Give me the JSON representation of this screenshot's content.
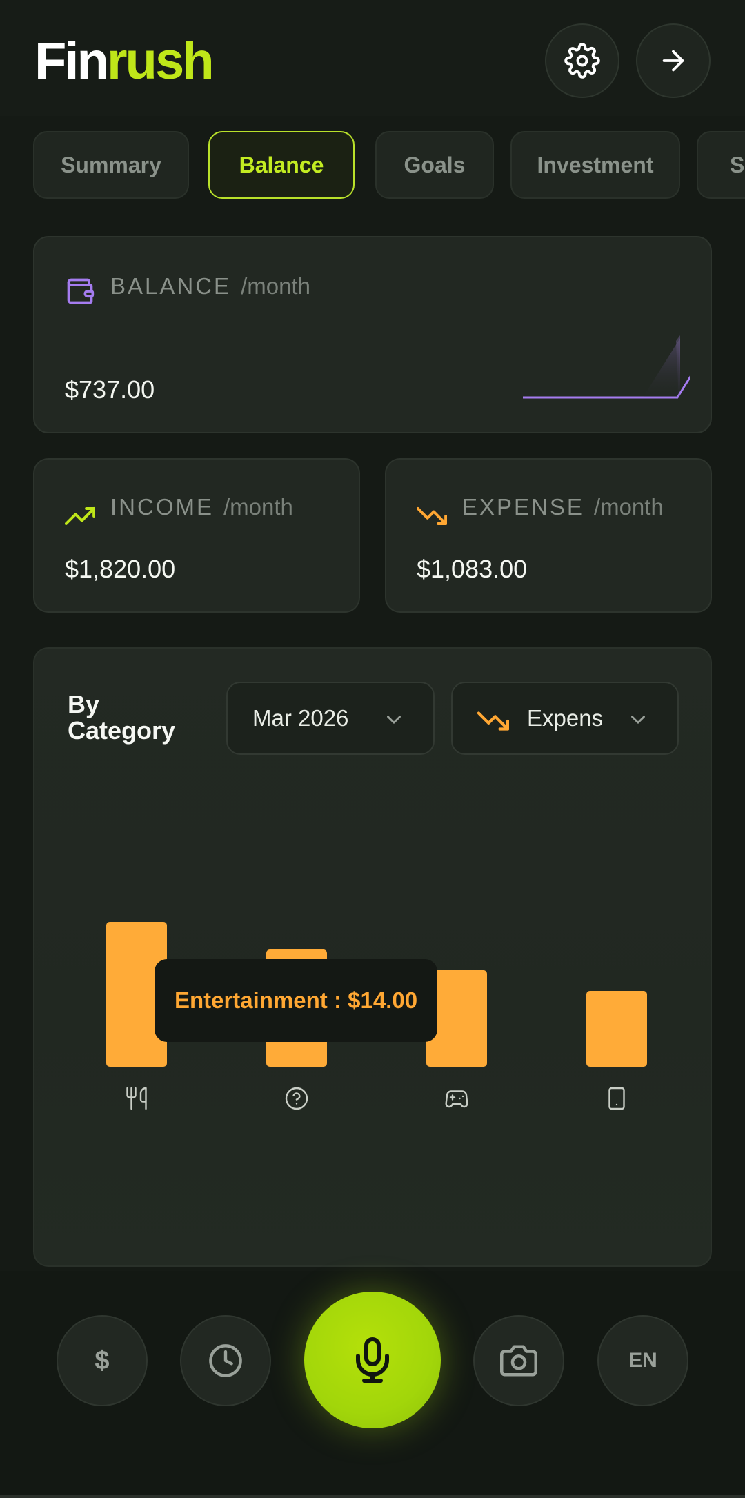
{
  "app": {
    "logo_part1": "Fin",
    "logo_part2": "rush"
  },
  "header": {
    "settings_icon": "gear-icon",
    "logout_icon": "arrow-right-icon"
  },
  "tabs": [
    {
      "label": "Summary",
      "active": false
    },
    {
      "label": "Balance",
      "active": true
    },
    {
      "label": "Goals",
      "active": false
    },
    {
      "label": "Investment",
      "active": false
    },
    {
      "label": "Savings",
      "active": false
    }
  ],
  "balance": {
    "label": "BALANCE",
    "period": "/month",
    "amount": "$737.00",
    "icon": "wallet-icon"
  },
  "income": {
    "label": "INCOME",
    "period": "/month",
    "amount": "$1,820.00",
    "icon": "trending-up-icon"
  },
  "expense": {
    "label": "EXPENSE",
    "period": "/month",
    "amount": "$1,083.00",
    "icon": "trending-down-icon"
  },
  "category": {
    "title_line1": "By",
    "title_line2": "Category",
    "month_select": "Mar 2026",
    "type_select": "Expense",
    "tooltip": "Entertainment : $14.00"
  },
  "chart_data": {
    "type": "bar",
    "categories": [
      "Food",
      "Other",
      "Entertainment",
      "Phone"
    ],
    "category_icons": [
      "utensils-icon",
      "help-circle-icon",
      "gamepad-icon",
      "smartphone-icon"
    ],
    "values": [
      21,
      17,
      14,
      11
    ],
    "bar_color": "#ffab38"
  },
  "bottom_nav": {
    "currency": "$",
    "history_icon": "clock-icon",
    "mic_icon": "microphone-icon",
    "camera_icon": "camera-icon",
    "language": "EN"
  },
  "colors": {
    "accent": "#bfe619",
    "expense": "#ffa733",
    "balance": "#a57cf0"
  }
}
